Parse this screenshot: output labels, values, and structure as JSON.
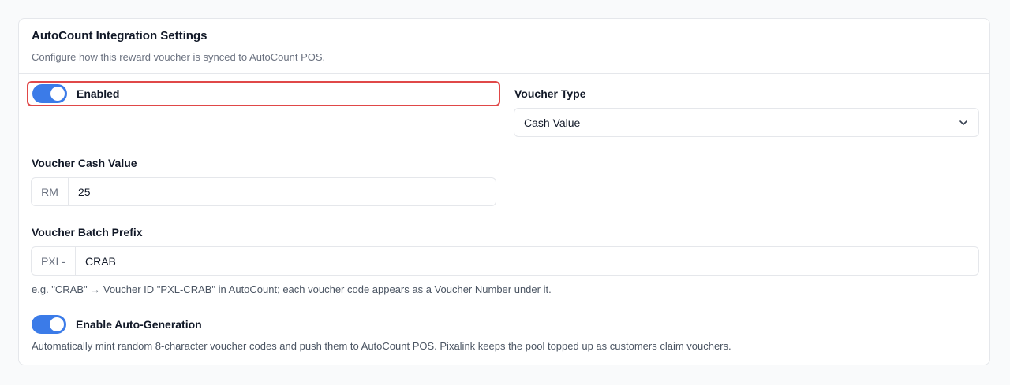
{
  "card": {
    "title": "AutoCount Integration Settings",
    "subtitle": "Configure how this reward voucher is synced to AutoCount POS."
  },
  "enabled_toggle": {
    "label": "Enabled",
    "on": true
  },
  "voucher_type": {
    "label": "Voucher Type",
    "selected": "Cash Value",
    "icon": "chevron-down-icon"
  },
  "cash_value": {
    "label": "Voucher Cash Value",
    "prefix": "RM",
    "value": "25"
  },
  "batch_prefix": {
    "label": "Voucher Batch Prefix",
    "prefix": "PXL-",
    "value": "CRAB",
    "help": "e.g. \"CRAB\" → Voucher ID \"PXL-CRAB\" in AutoCount; each voucher code appears as a Voucher Number under it."
  },
  "auto_generation": {
    "label": "Enable Auto-Generation",
    "on": true,
    "help": "Automatically mint random 8-character voucher codes and push them to AutoCount POS. Pixalink keeps the pool topped up as customers claim vouchers."
  },
  "colors": {
    "accent": "#3b7be8",
    "highlight_border": "#e04848",
    "border": "#e5e7eb",
    "muted_text": "#6b7280"
  }
}
